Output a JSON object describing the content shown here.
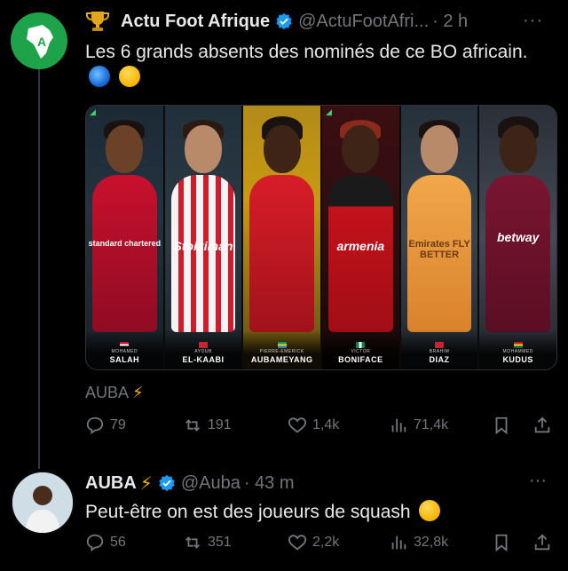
{
  "tweet1": {
    "display_name": "Actu Foot Afrique",
    "handle": "@ActuFootAfri...",
    "time": "· 2 h",
    "more": "···",
    "text": "Les 6 grands absents des nominés de ce BO africain.",
    "emojis": [
      "globe-icon",
      "astonished-face-icon"
    ]
  },
  "media": {
    "players": [
      {
        "first": "MOHAMED",
        "last": "SALAH",
        "sponsor": "standard chartered"
      },
      {
        "first": "AYOUB",
        "last": "EL-KAABI",
        "sponsor": "Stoiximan"
      },
      {
        "first": "PIERRE-EMERICK",
        "last": "AUBAMEYANG",
        "sponsor": ""
      },
      {
        "first": "VICTOR",
        "last": "BONIFACE",
        "sponsor": "armenia"
      },
      {
        "first": "BRAHIM",
        "last": "DIAZ",
        "sponsor": "Emirates FLY BETTER"
      },
      {
        "first": "MOHAMMED",
        "last": "KUDUS",
        "sponsor": "betway"
      }
    ]
  },
  "reply_context": {
    "text": "AUBA",
    "bolt": "⚡"
  },
  "stats1": {
    "replies": "79",
    "reposts": "191",
    "likes": "1,4k",
    "views": "71,4k"
  },
  "tweet2": {
    "display_name": "AUBA",
    "bolt": "⚡",
    "handle": "@Auba",
    "time": "· 43 m",
    "more": "···",
    "text": "Peut-être on est des joueurs de squash",
    "emoji": "thinking-face-icon"
  },
  "stats2": {
    "replies": "56",
    "reposts": "351",
    "likes": "2,2k",
    "views": "32,8k"
  },
  "colors": {
    "background": "#000000",
    "text": "#e7e9ea",
    "muted": "#71767b",
    "verified": "#1d9bf0",
    "bolt": "#f4b400"
  }
}
